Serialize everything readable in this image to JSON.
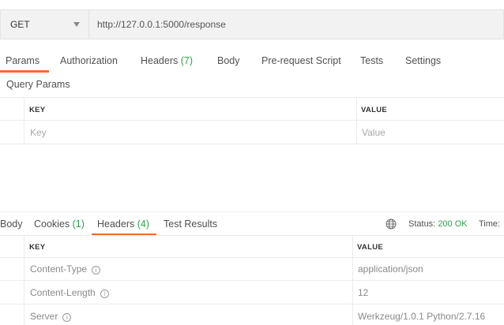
{
  "request": {
    "method": "GET",
    "url": "http://127.0.0.1:5000/response"
  },
  "request_tabs": [
    {
      "label": "Params",
      "count": ""
    },
    {
      "label": "Authorization",
      "count": ""
    },
    {
      "label": "Headers ",
      "count": "(7)"
    },
    {
      "label": "Body",
      "count": ""
    },
    {
      "label": "Pre-request Script",
      "count": ""
    },
    {
      "label": "Tests",
      "count": ""
    },
    {
      "label": "Settings",
      "count": ""
    }
  ],
  "query_params": {
    "title": "Query Params",
    "key_header": "KEY",
    "value_header": "VALUE",
    "key_placeholder": "Key",
    "value_placeholder": "Value"
  },
  "response_tabs": [
    {
      "label": "Body",
      "count": ""
    },
    {
      "label": "Cookies ",
      "count": "(1)"
    },
    {
      "label": "Headers ",
      "count": "(4)"
    },
    {
      "label": "Test Results",
      "count": ""
    }
  ],
  "response_status": {
    "status_label": "Status:",
    "status_value": "200 OK",
    "time_label": "Time:"
  },
  "response_headers": {
    "key_header": "KEY",
    "value_header": "VALUE",
    "rows": [
      {
        "key": "Content-Type",
        "value": "application/json"
      },
      {
        "key": "Content-Length",
        "value": "12"
      },
      {
        "key": "Server",
        "value": "Werkzeug/1.0.1 Python/2.7.16"
      }
    ]
  },
  "colors": {
    "accent": "#f26b3a",
    "success": "#2f9f4b"
  },
  "icons": {
    "method_dropdown": "chevron-down-icon",
    "network": "globe-icon",
    "info": "info-icon"
  }
}
